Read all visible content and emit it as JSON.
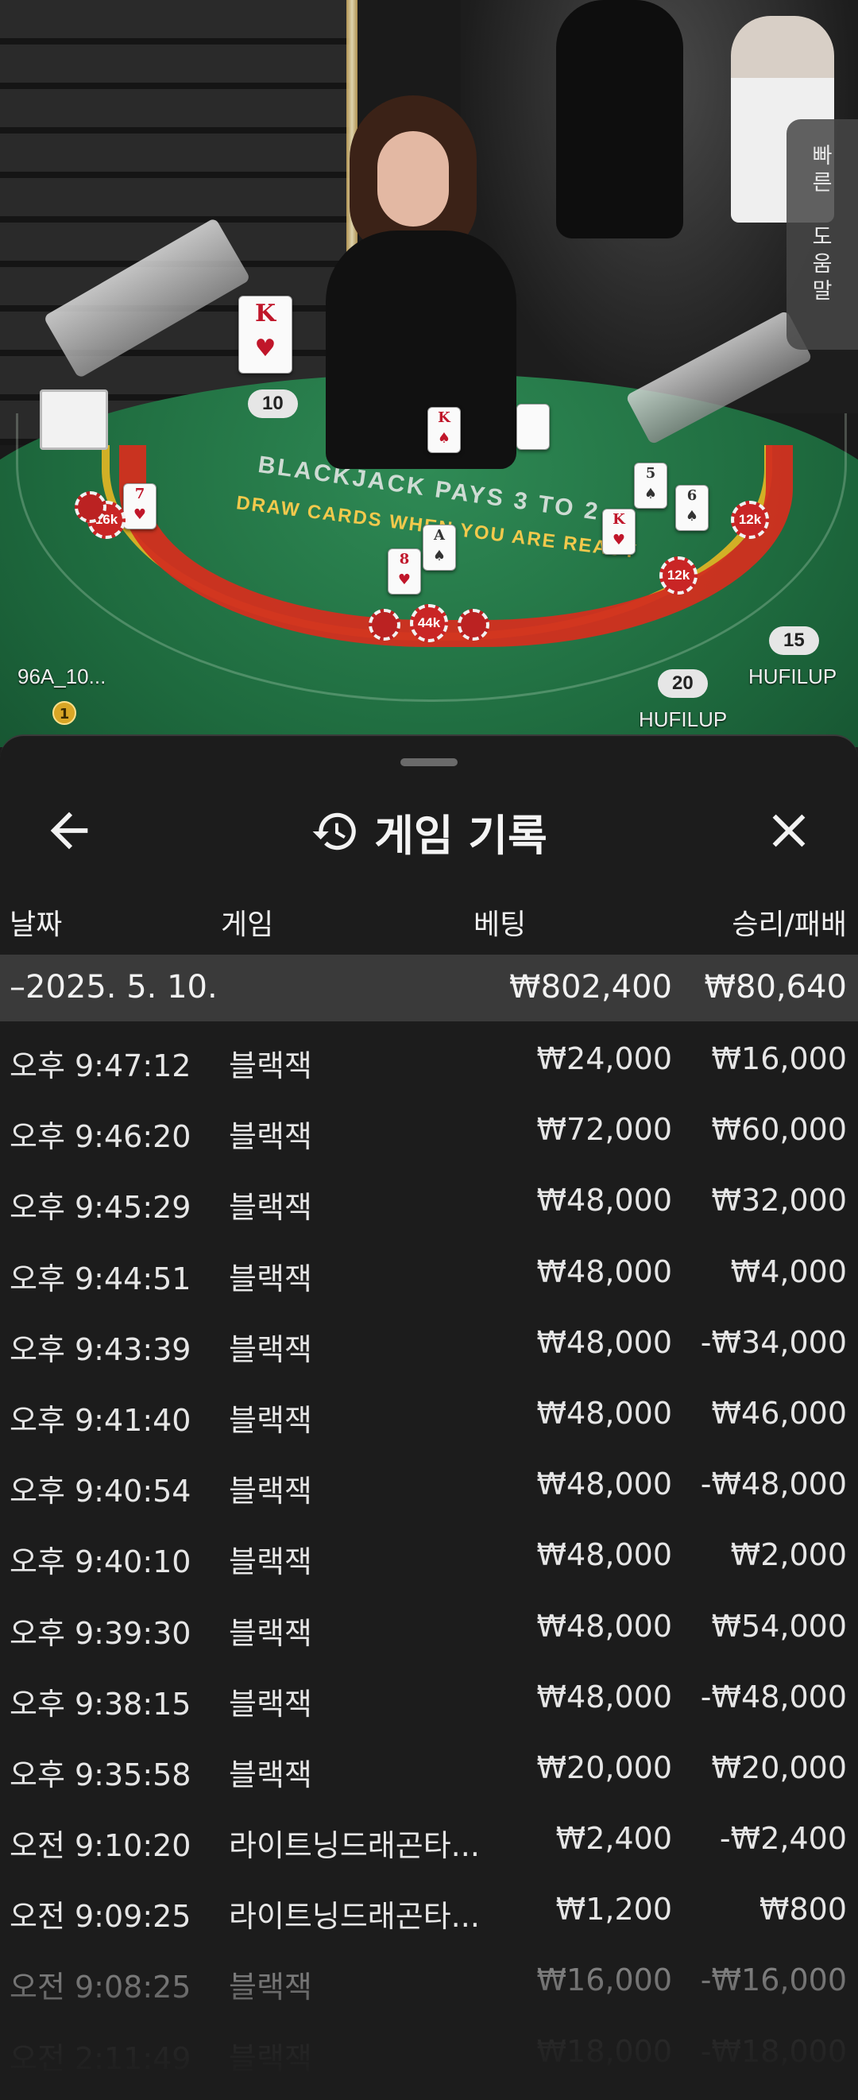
{
  "stage": {
    "help_tab": [
      "빠",
      "른",
      "도",
      "움",
      "말"
    ],
    "dealer_card_rank": "K",
    "player_totals": {
      "dealer_left": "10",
      "right_seat": "15",
      "bottom_seat": "20"
    },
    "player_names": {
      "left_seat": "96A_10...",
      "right_seat": "HUFILUP",
      "bottom_seat": "HUFILUP"
    },
    "medal_rank": "1",
    "chips": [
      "16k",
      "12k",
      "12k",
      "44k"
    ],
    "table_line1": "BLACKJACK PAYS 3 TO 2",
    "table_line2": "DRAW CARDS WHEN YOU ARE READY"
  },
  "panel": {
    "title": "게임 기록",
    "icons": {
      "back": "arrow-left-icon",
      "history": "history-icon",
      "close": "close-icon"
    },
    "columns": {
      "date": "날짜",
      "game": "게임",
      "bet": "베팅",
      "result": "승리/패배"
    },
    "summary": {
      "date": "–2025. 5. 10.",
      "bet": "₩802,400",
      "result": "₩80,640"
    },
    "rows": [
      {
        "time": "오후 9:47:12",
        "game": "블랙잭",
        "bet": "₩24,000",
        "result": "₩16,000"
      },
      {
        "time": "오후 9:46:20",
        "game": "블랙잭",
        "bet": "₩72,000",
        "result": "₩60,000"
      },
      {
        "time": "오후 9:45:29",
        "game": "블랙잭",
        "bet": "₩48,000",
        "result": "₩32,000"
      },
      {
        "time": "오후 9:44:51",
        "game": "블랙잭",
        "bet": "₩48,000",
        "result": "₩4,000"
      },
      {
        "time": "오후 9:43:39",
        "game": "블랙잭",
        "bet": "₩48,000",
        "result": "-₩34,000"
      },
      {
        "time": "오후 9:41:40",
        "game": "블랙잭",
        "bet": "₩48,000",
        "result": "₩46,000"
      },
      {
        "time": "오후 9:40:54",
        "game": "블랙잭",
        "bet": "₩48,000",
        "result": "-₩48,000"
      },
      {
        "time": "오후 9:40:10",
        "game": "블랙잭",
        "bet": "₩48,000",
        "result": "₩2,000"
      },
      {
        "time": "오후 9:39:30",
        "game": "블랙잭",
        "bet": "₩48,000",
        "result": "₩54,000"
      },
      {
        "time": "오후 9:38:15",
        "game": "블랙잭",
        "bet": "₩48,000",
        "result": "-₩48,000"
      },
      {
        "time": "오후 9:35:58",
        "game": "블랙잭",
        "bet": "₩20,000",
        "result": "₩20,000"
      },
      {
        "time": "오전 9:10:20",
        "game": "라이트닝드래곤타...",
        "bet": "₩2,400",
        "result": "-₩2,400"
      },
      {
        "time": "오전 9:09:25",
        "game": "라이트닝드래곤타...",
        "bet": "₩1,200",
        "result": "₩800"
      },
      {
        "time": "오전 9:08:25",
        "game": "블랙잭",
        "bet": "₩16,000",
        "result": "-₩16,000"
      },
      {
        "time": "오전 2:11:49",
        "game": "블랙잭",
        "bet": "₩18,000",
        "result": "-₩18,000"
      }
    ]
  }
}
